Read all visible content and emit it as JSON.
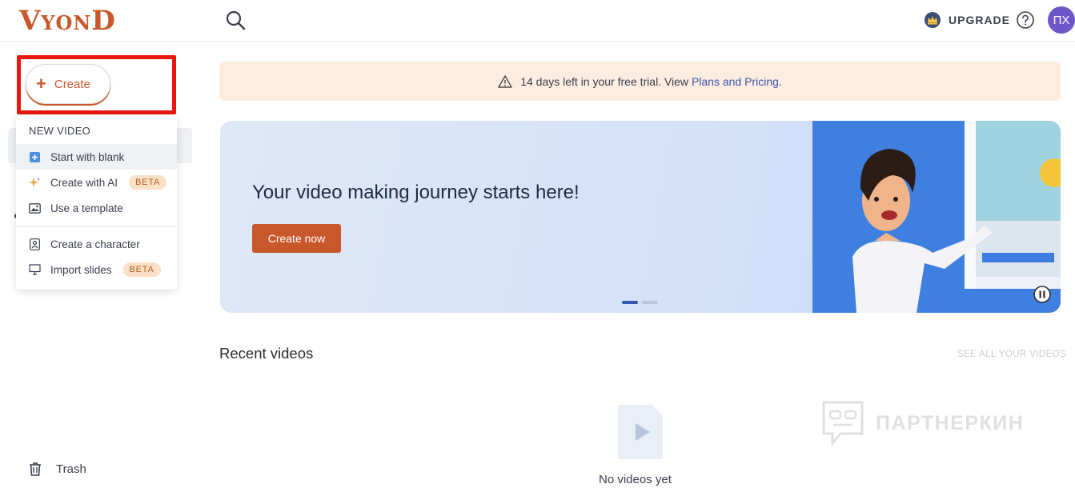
{
  "header": {
    "logo_text_big_1": "V",
    "logo_text_small": "YON",
    "logo_text_big_2": "D",
    "upgrade_label": "UPGRADE",
    "avatar_initials": "ПХ"
  },
  "sidebar": {
    "create_label": "Create",
    "menu": {
      "section_label": "NEW VIDEO",
      "items": [
        {
          "label": "Start with blank",
          "icon": "plus-square-icon"
        },
        {
          "label": "Create with AI",
          "icon": "sparkle-icon",
          "badge": "BETA"
        },
        {
          "label": "Use a template",
          "icon": "image-icon"
        },
        {
          "label": "Create a character",
          "icon": "character-icon"
        },
        {
          "label": "Import slides",
          "icon": "slides-icon",
          "badge": "BETA"
        }
      ]
    },
    "trash_label": "Trash"
  },
  "trial": {
    "text": "14 days left in your free trial. View ",
    "link": "Plans and Pricing",
    "suffix": "."
  },
  "hero": {
    "title": "Your video making journey starts here!",
    "cta": "Create now"
  },
  "recent": {
    "title": "Recent videos",
    "see_all": "SEE ALL YOUR VIDEOS",
    "empty": "No videos yet"
  },
  "watermark": {
    "text": "ПАРТНЕРКИН"
  },
  "colors": {
    "brand": "#c8582b",
    "highlight": "#e8180e",
    "avatar": "#6d56c9",
    "banner": "#fdece0",
    "link": "#3a56a8"
  }
}
